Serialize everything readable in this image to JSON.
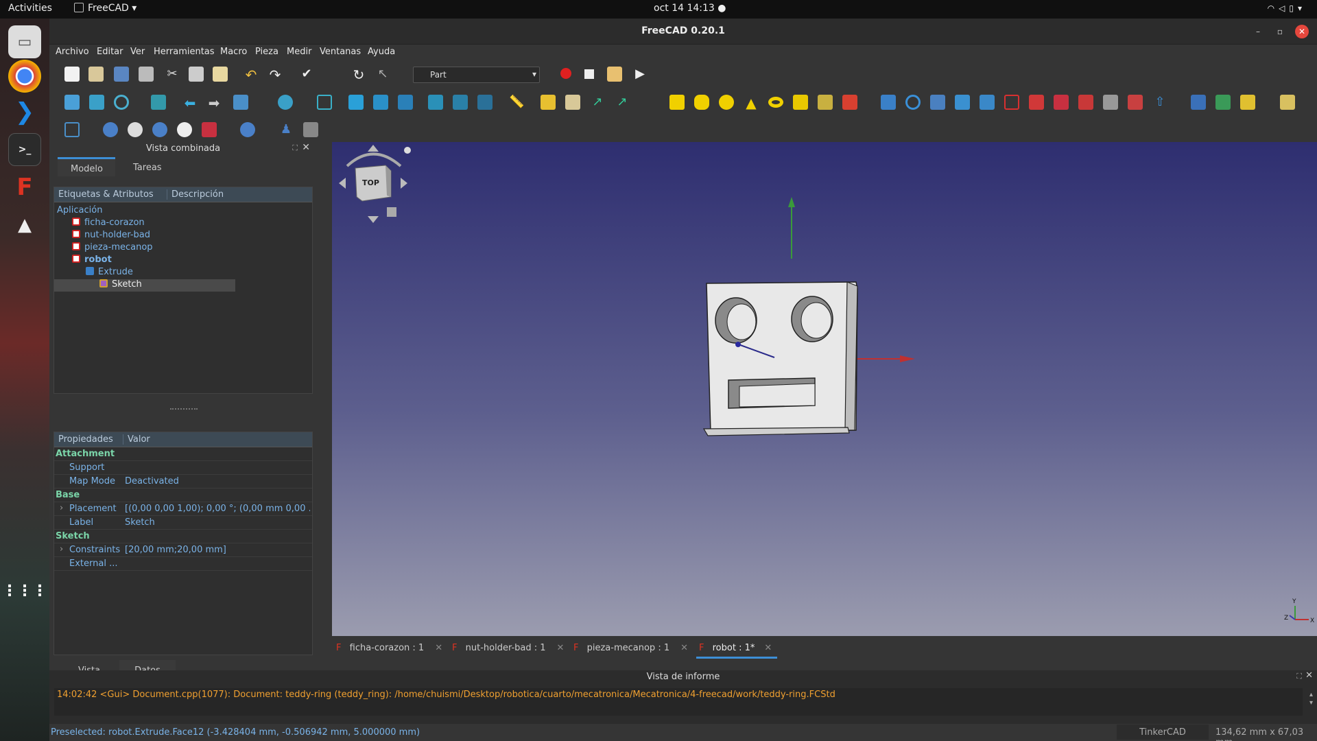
{
  "topbar": {
    "activities": "Activities",
    "app_name": "FreeCAD",
    "clock": "oct 14  14:13"
  },
  "window": {
    "title": "FreeCAD 0.20.1"
  },
  "menu": [
    "Archivo",
    "Editar",
    "Ver",
    "Herramientas",
    "Macro",
    "Pieza",
    "Medir",
    "Ventanas",
    "Ayuda"
  ],
  "toolbar": {
    "workbench": "Part"
  },
  "combo_view": {
    "title": "Vista combinada",
    "tabs": [
      "Modelo",
      "Tareas"
    ],
    "tree_headers": [
      "Etiquetas & Atributos",
      "Descripción"
    ],
    "root": "Aplicación",
    "documents": [
      "ficha-corazon",
      "nut-holder-bad",
      "pieza-mecanop",
      "robot"
    ],
    "robot_children": [
      "Extrude",
      "Sketch"
    ]
  },
  "properties": {
    "headers": [
      "Propiedades",
      "Valor"
    ],
    "groups": [
      {
        "name": "Attachment",
        "rows": [
          [
            "Support",
            ""
          ],
          [
            "Map Mode",
            "Deactivated"
          ]
        ]
      },
      {
        "name": "Base",
        "rows": [
          [
            "Placement",
            "[(0,00 0,00 1,00); 0,00 °; (0,00 mm  0,00 ..."
          ],
          [
            "Label",
            "Sketch"
          ]
        ]
      },
      {
        "name": "Sketch",
        "rows": [
          [
            "Constraints",
            "[20,00 mm;20,00 mm]"
          ],
          [
            "External ...",
            ""
          ]
        ]
      }
    ],
    "bottom_tabs": [
      "Vista",
      "Datos"
    ]
  },
  "navcube": {
    "face": "TOP"
  },
  "axis_labels": {
    "y": "Y",
    "x": "X",
    "z": "Z"
  },
  "doc_tabs": [
    "ficha-corazon : 1",
    "nut-holder-bad : 1",
    "pieza-mecanop : 1",
    "robot : 1*"
  ],
  "report": {
    "title": "Vista de informe",
    "line": "14:02:42  <Gui> Document.cpp(1077):   Document: teddy-ring (teddy_ring): /home/chuismi/Desktop/robotica/cuarto/mecatronica/Mecatronica/4-freecad/work/teddy-ring.FCStd"
  },
  "status": {
    "preselected": "Preselected: robot.Extrude.Face12 (-3.428404 mm, -0.506942 mm, 5.000000 mm)",
    "nav_style": "TinkerCAD",
    "dimensions": "134,62 mm x 67,03 mm"
  },
  "colors": {
    "accent": "#3d8fd6",
    "tree_text": "#7ab3e8",
    "group_text": "#7ad4a8",
    "log_text": "#f0a030"
  }
}
